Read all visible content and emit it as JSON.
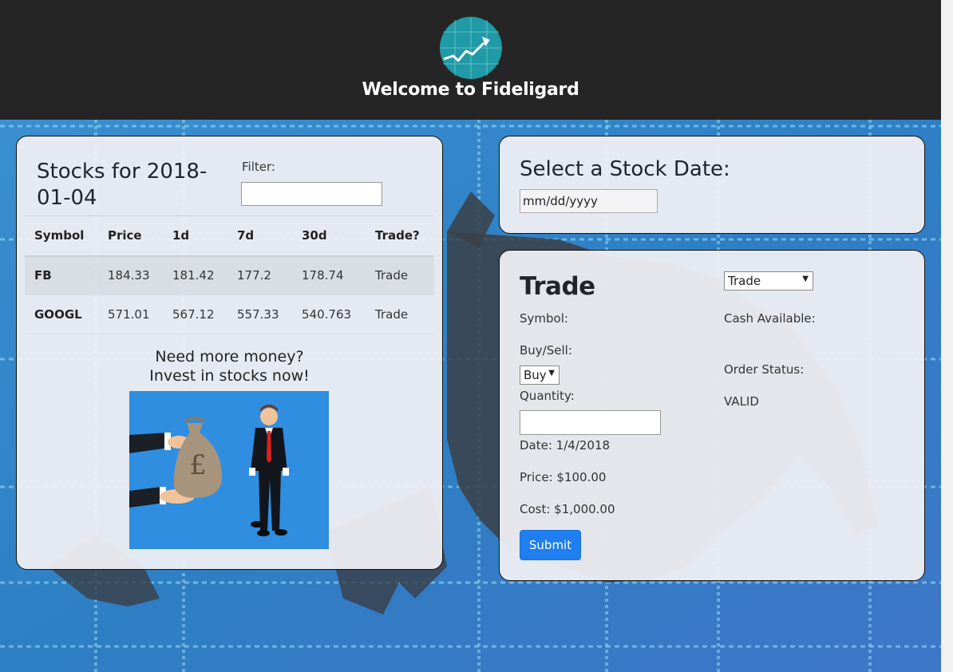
{
  "header": {
    "site_title": "Welcome to Fideligard",
    "logo_icon": "trending-chart-icon"
  },
  "stocks_panel": {
    "title": "Stocks for 2018-01-04",
    "filter_label": "Filter:",
    "filter_value": "",
    "columns": [
      "Symbol",
      "Price",
      "1d",
      "7d",
      "30d",
      "Trade?"
    ],
    "rows": [
      {
        "symbol": "FB",
        "price": "184.33",
        "d1": "181.42",
        "d7": "177.2",
        "d30": "178.74",
        "trade": "Trade"
      },
      {
        "symbol": "GOOGL",
        "price": "571.01",
        "d1": "567.12",
        "d7": "557.33",
        "d30": "540.763",
        "trade": "Trade"
      }
    ],
    "promo_line1": "Need more money?",
    "promo_line2": "Invest in stocks now!",
    "promo_image": "money-bag-businessman-illustration"
  },
  "date_panel": {
    "title": "Select a Stock Date:",
    "date_placeholder": "mm/dd/yyyy"
  },
  "trade_panel": {
    "title": "Trade",
    "view_select": "Trade",
    "symbol_label": "Symbol:",
    "buysell_label": "Buy/Sell:",
    "buysell_value": "Buy",
    "quantity_label": "Quantity:",
    "quantity_value": "",
    "date_text": "Date: 1/4/2018",
    "price_text": "Price: $100.00",
    "cost_text": "Cost: $1,000.00",
    "submit_label": "Submit",
    "cash_label": "Cash Available:",
    "order_status_label": "Order Status:",
    "order_status_value": "VALID"
  },
  "colors": {
    "header_bg": "#252525",
    "accent_button": "#1f7ef0",
    "logo_bg": "#1f9aa6"
  }
}
